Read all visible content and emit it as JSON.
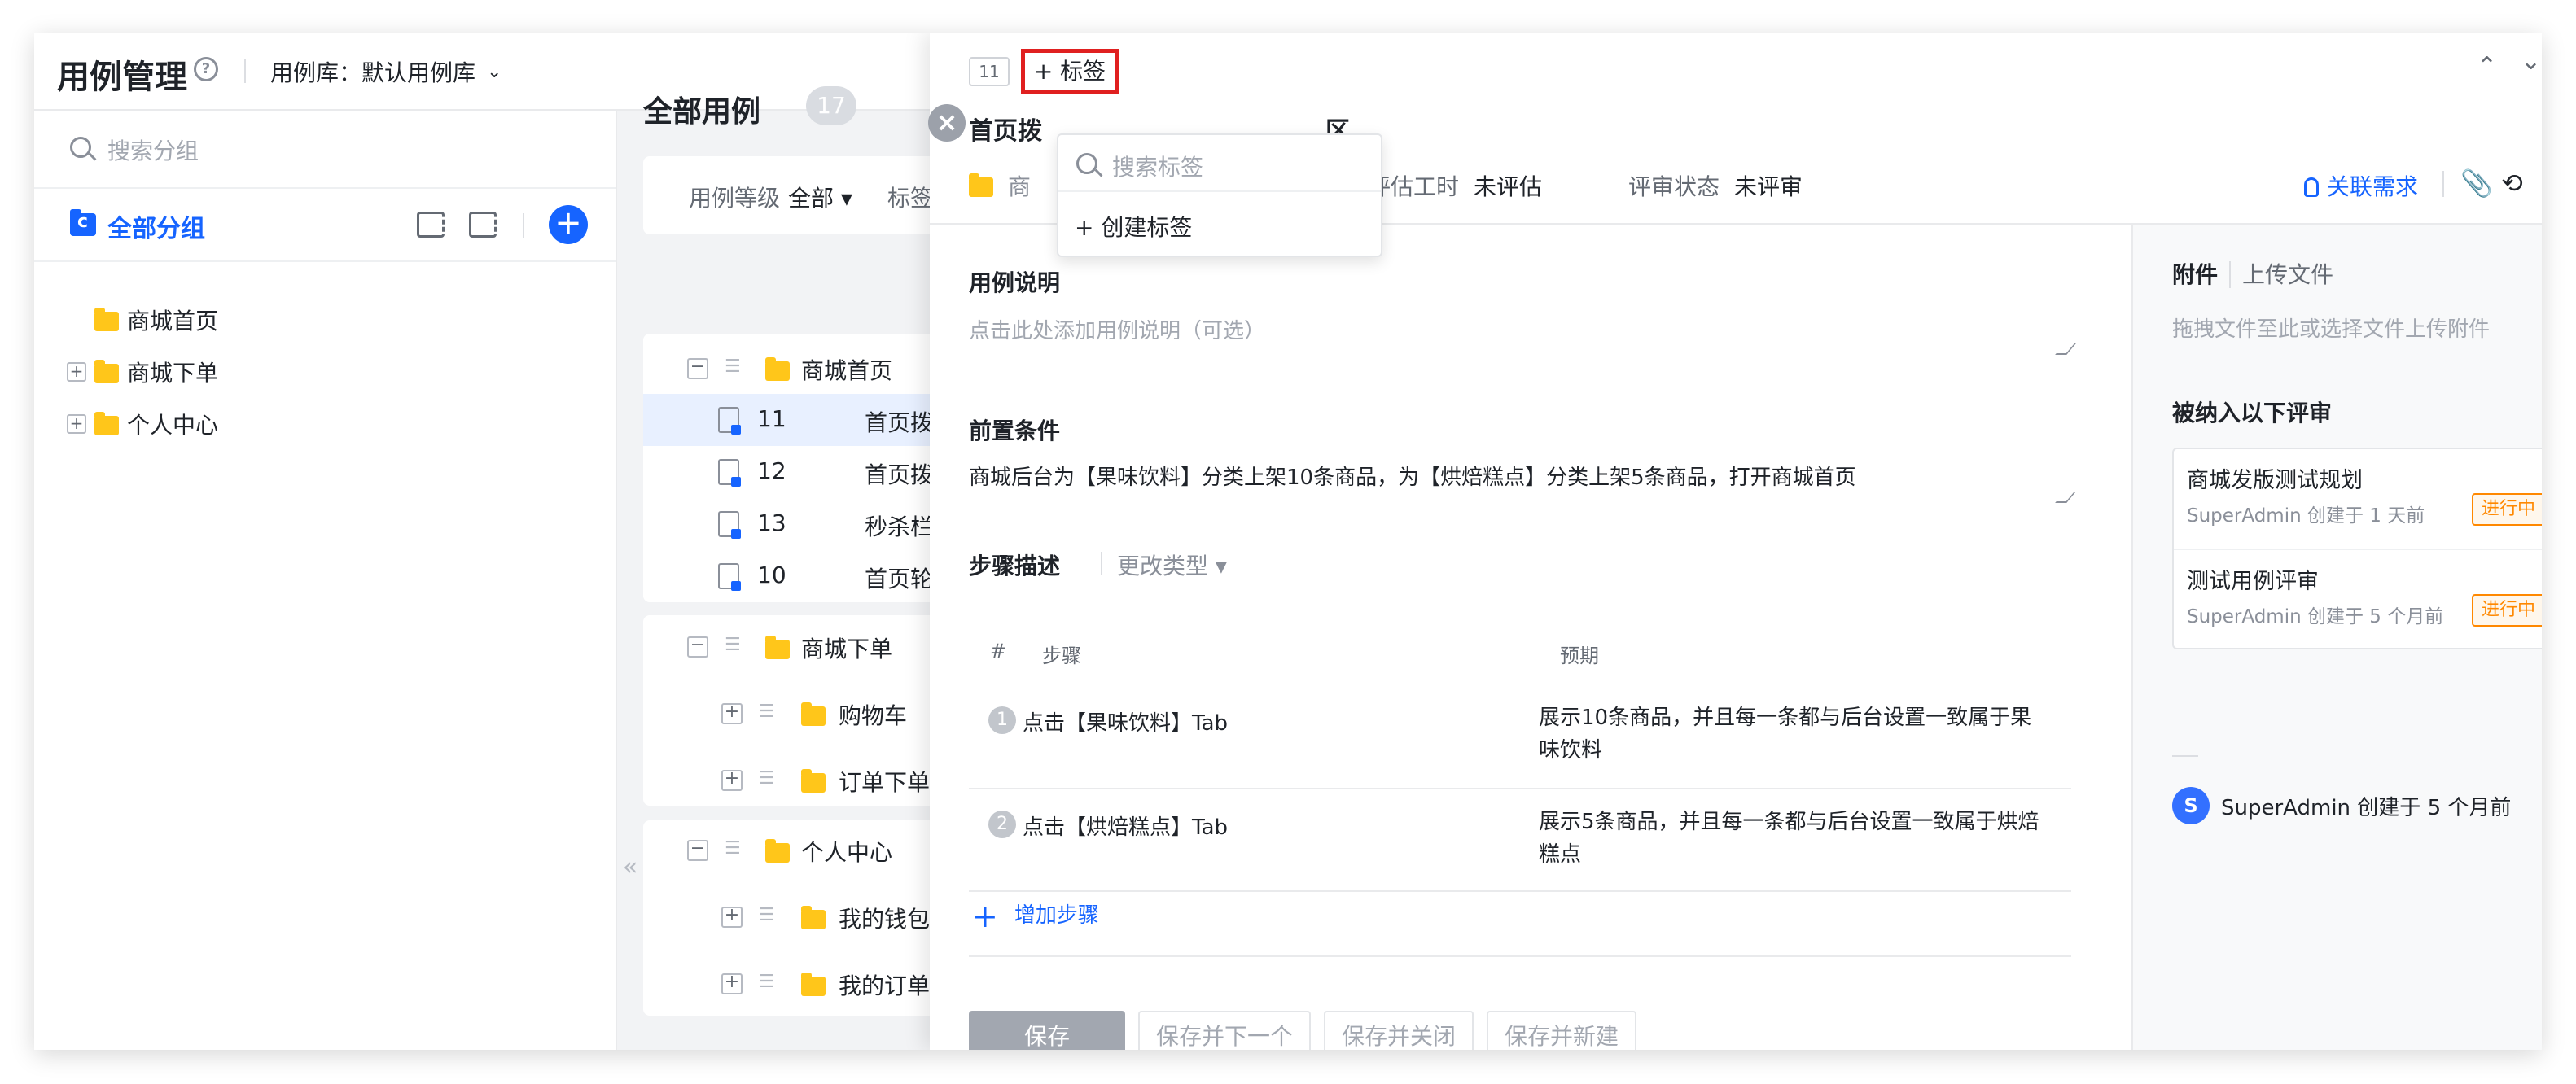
{
  "header": {
    "title": "用例管理",
    "help_icon": "?",
    "library_label": "用例库：默认用例库",
    "chevron": "⌄"
  },
  "sidebar": {
    "search_placeholder": "搜索分组",
    "all_groups": "全部分组",
    "add": "+",
    "tree": [
      {
        "label": "商城首页",
        "expandable": false
      },
      {
        "label": "商城下单",
        "expandable": true
      },
      {
        "label": "个人中心",
        "expandable": true
      }
    ],
    "expand_symbol": "+"
  },
  "list": {
    "title": "全部用例",
    "count": "17",
    "filter_level_label": "用例等级",
    "filter_level_value": "全部 ▾",
    "filter_tag_label": "标签",
    "collapse_symbol": "«",
    "groups": [
      {
        "name": "商城首页",
        "rows": [
          {
            "id": "11",
            "name": "首页拨"
          },
          {
            "id": "12",
            "name": "首页拨"
          },
          {
            "id": "13",
            "name": "秒杀栏"
          },
          {
            "id": "10",
            "name": "首页轮"
          }
        ]
      },
      {
        "name": "商城下单",
        "subgroups": [
          "购物车",
          "订单下单"
        ]
      },
      {
        "name": "个人中心",
        "subgroups": [
          "我的钱包",
          "我的订单"
        ]
      }
    ],
    "minus_symbol": "−",
    "plus_symbol": "+"
  },
  "drawer": {
    "close_symbol": "×",
    "id_badge": "11",
    "tag_button": "+ 标签",
    "nav_up": "⌃",
    "nav_down": "⌄",
    "title_left": "首页拨",
    "title_right": "区",
    "meta": {
      "group_short": "商",
      "estimate_label": "评估工时",
      "estimate_value": "未评估",
      "review_label": "评审状态",
      "review_value": "未评审",
      "link_requirement": "关联需求",
      "attach_icon": "📎",
      "history_icon": "⟲",
      "more_icon": "···"
    },
    "popover": {
      "search_placeholder": "搜索标签",
      "create_label": "+ 创建标签"
    },
    "description": {
      "label": "用例说明",
      "placeholder": "点击此处添加用例说明（可选）"
    },
    "precondition": {
      "label": "前置条件",
      "value": "商城后台为【果味饮料】分类上架10条商品，为【烘焙糕点】分类上架5条商品，打开商城首页"
    },
    "steps": {
      "label": "步骤描述",
      "change_type": "更改类型 ▾",
      "col_index": "#",
      "col_step": "步骤",
      "col_expect": "预期",
      "rows": [
        {
          "num": "1",
          "step": "点击【果味饮料】Tab",
          "expect": "展示10条商品，并且每一条都与后台设置一致属于果味饮料"
        },
        {
          "num": "2",
          "step": "点击【烘焙糕点】Tab",
          "expect": "展示5条商品，并且每一条都与后台设置一致属于烘焙糕点"
        }
      ],
      "add_plus": "+",
      "add_label": "增加步骤"
    },
    "buttons": {
      "save": "保存",
      "save_next": "保存并下一个",
      "save_close": "保存并关闭",
      "save_new": "保存并新建"
    },
    "side": {
      "attachments": "附件",
      "upload": "上传文件",
      "upload_hint": "拖拽文件至此或选择文件上传附件",
      "reviews_title": "被纳入以下评审",
      "reviews": [
        {
          "name": "商城发版测试规划",
          "meta": "SuperAdmin 创建于 1 天前",
          "status": "进行中"
        },
        {
          "name": "测试用例评审",
          "meta": "SuperAdmin 创建于 5 个月前",
          "status": "进行中"
        }
      ],
      "avatar_letter": "S",
      "creator": "SuperAdmin 创建于 5 个月前"
    }
  },
  "colors": {
    "accent": "#1664ff",
    "tag_highlight": "#e02020",
    "status_orange": "#ff8800",
    "folder_yellow": "#ffc61a"
  }
}
